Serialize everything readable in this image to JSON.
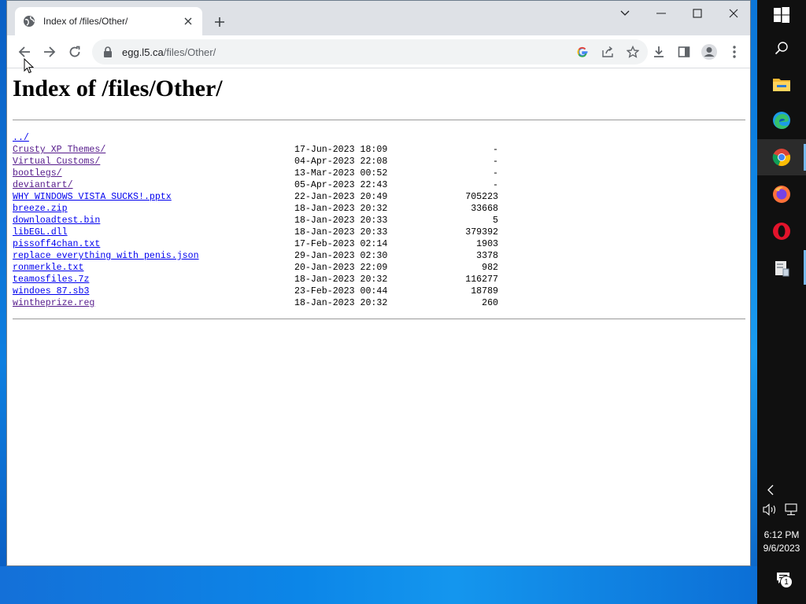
{
  "browser": {
    "tab_title": "Index of /files/Other/",
    "url_host": "egg.l5.ca",
    "url_path": "/files/Other/"
  },
  "page": {
    "heading": "Index of /files/Other/",
    "entries": [
      {
        "name": "../",
        "date": "",
        "size": "",
        "visited": false
      },
      {
        "name": "Crusty XP Themes/",
        "date": "17-Jun-2023 18:09",
        "size": "-",
        "visited": true
      },
      {
        "name": "Virtual Customs/",
        "date": "04-Apr-2023 22:08",
        "size": "-",
        "visited": true
      },
      {
        "name": "bootlegs/",
        "date": "13-Mar-2023 00:52",
        "size": "-",
        "visited": true
      },
      {
        "name": "deviantart/",
        "date": "05-Apr-2023 22:43",
        "size": "-",
        "visited": true
      },
      {
        "name": "WHY WINDOWS VISTA SUCKS!.pptx",
        "date": "22-Jan-2023 20:49",
        "size": "705223",
        "visited": false
      },
      {
        "name": "breeze.zip",
        "date": "18-Jan-2023 20:32",
        "size": "33668",
        "visited": false
      },
      {
        "name": "downloadtest.bin",
        "date": "18-Jan-2023 20:33",
        "size": "5",
        "visited": false
      },
      {
        "name": "libEGL.dll",
        "date": "18-Jan-2023 20:33",
        "size": "379392",
        "visited": false
      },
      {
        "name": "pissoff4chan.txt",
        "date": "17-Feb-2023 02:14",
        "size": "1903",
        "visited": false
      },
      {
        "name": "replace everything with penis.json",
        "date": "29-Jan-2023 02:30",
        "size": "3378",
        "visited": false
      },
      {
        "name": "ronmerkle.txt",
        "date": "20-Jan-2023 22:09",
        "size": "982",
        "visited": false
      },
      {
        "name": "teamosfiles.7z",
        "date": "18-Jan-2023 20:32",
        "size": "116277",
        "visited": false
      },
      {
        "name": "windoes 87.sb3",
        "date": "23-Feb-2023 00:44",
        "size": "18789",
        "visited": false
      },
      {
        "name": "wintheprize.reg",
        "date": "18-Jan-2023 20:32",
        "size": "260",
        "visited": true
      }
    ]
  },
  "taskbar": {
    "apps": [
      "start-icon",
      "search-icon",
      "file-explorer-icon",
      "edge-icon",
      "chrome-icon",
      "firefox-icon",
      "opera-icon",
      "app-icon"
    ],
    "time": "6:12 PM",
    "date": "9/6/2023",
    "notification_count": "1"
  },
  "colors": {
    "link": "#0000ee",
    "visited_link": "#551a8b",
    "tabbar_bg": "#dee1e6",
    "taskbar_bg": "#101010"
  }
}
